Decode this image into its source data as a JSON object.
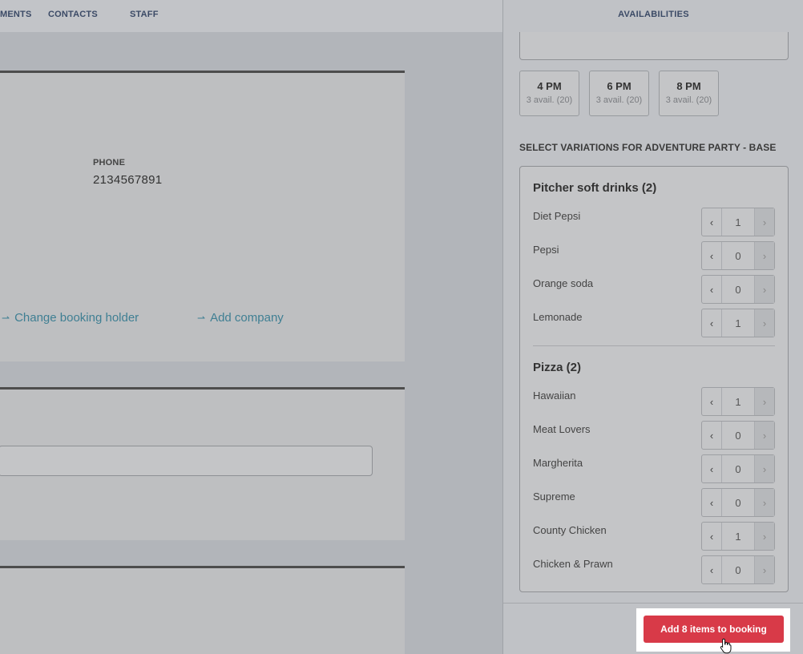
{
  "nav": {
    "items": [
      "MENTS",
      "CONTACTS",
      "STAFF"
    ]
  },
  "contact": {
    "phone_label": "PHONE",
    "phone_value": "2134567891",
    "change_holder_link": "Change booking holder",
    "add_company_link": "Add company"
  },
  "panel": {
    "title": "AVAILABILITIES",
    "time_slots": [
      {
        "time": "4 PM",
        "avail": "3 avail. (20)"
      },
      {
        "time": "6 PM",
        "avail": "3 avail. (20)"
      },
      {
        "time": "8 PM",
        "avail": "3 avail. (20)"
      }
    ],
    "variations_heading": "SELECT VARIATIONS FOR ADVENTURE PARTY - BASE",
    "groups": [
      {
        "title": "Pitcher soft drinks (2)",
        "items": [
          {
            "name": "Diet Pepsi",
            "qty": "1"
          },
          {
            "name": "Pepsi",
            "qty": "0"
          },
          {
            "name": "Orange soda",
            "qty": "0"
          },
          {
            "name": "Lemonade",
            "qty": "1"
          }
        ]
      },
      {
        "title": "Pizza (2)",
        "items": [
          {
            "name": "Hawaiian",
            "qty": "1"
          },
          {
            "name": "Meat Lovers",
            "qty": "0"
          },
          {
            "name": "Margherita",
            "qty": "0"
          },
          {
            "name": "Supreme",
            "qty": "0"
          },
          {
            "name": "County Chicken",
            "qty": "1"
          },
          {
            "name": "Chicken & Prawn",
            "qty": "0"
          }
        ]
      }
    ],
    "stepper": {
      "dec": "‹",
      "inc": "›"
    },
    "add_button": "Add 8 items to booking"
  },
  "icons": {
    "link": "arrow-swap-icon",
    "cursor": "hand-pointer-icon"
  },
  "colors": {
    "primary_button": "#d83a48",
    "link": "#3f7f93",
    "nav_text": "#3b4a66"
  }
}
